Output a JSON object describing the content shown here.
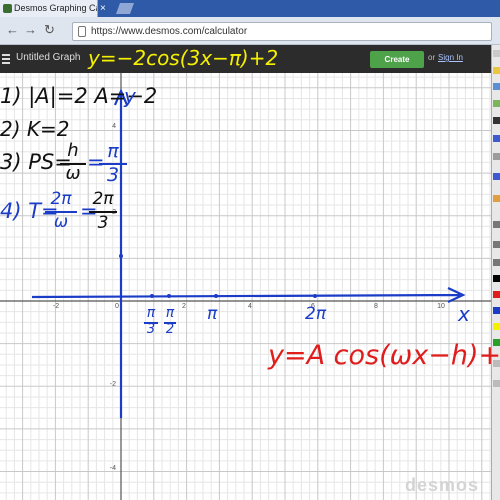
{
  "browser": {
    "tab_title": "Desmos Graphing Calcula",
    "url": "https://www.desmos.com/calculator"
  },
  "header": {
    "graph_title": "Untitled Graph",
    "create_account": "Create Account",
    "or": "or",
    "sign_in": "Sign In"
  },
  "graph": {
    "x_ticks": [
      "-2",
      "0",
      "2",
      "4",
      "6",
      "8",
      "10"
    ],
    "y_ticks": [
      "4",
      "2",
      "-2",
      "-4"
    ],
    "watermark": "desmos"
  },
  "annotations": {
    "top_equation": "y=−2cos(3x−π)+2",
    "step1": "1) |A|=2  A=−2",
    "step2": "2) K=2",
    "step3_lhs": "3) PS=",
    "step3_frac_num": "h",
    "step3_frac_den": "ω",
    "step3_eq": "=",
    "step3_num": "π",
    "step3_den": "3",
    "step4_lhs": "4) T=",
    "step4_f1_num": "2π",
    "step4_f1_den": "ω",
    "step4_eq": "=",
    "step4_f2_num": "2π",
    "step4_f2_den": "3",
    "axis_y": "y",
    "axis_x": "x",
    "mark_pi3_num": "π",
    "mark_pi3_den": "3",
    "mark_pi2_num": "π",
    "mark_pi2_den": "2",
    "mark_pi": "π",
    "mark_2pi": "2π",
    "general_form": "y=A cos(ωx−h)+K"
  },
  "colors": {
    "desmos_header": "#2c2c2c",
    "create_account_green": "#4ea24a",
    "pen_yellow": "#f5f000",
    "pen_blue": "#1a3cc7",
    "pen_red": "#e01c1c",
    "pen_black": "#111111"
  }
}
